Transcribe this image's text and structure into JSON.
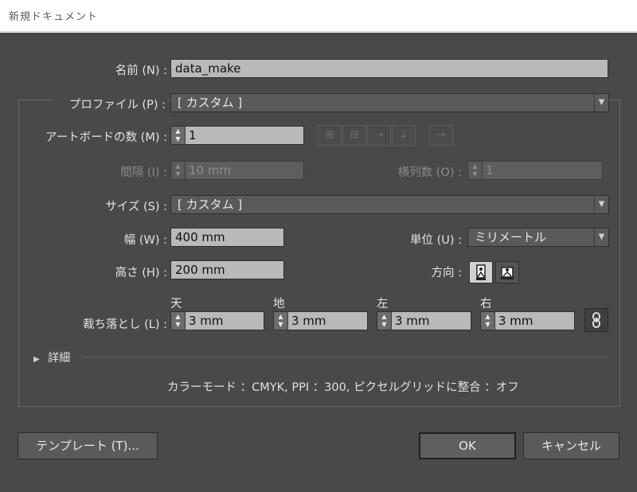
{
  "window": {
    "title": "新規ドキュメント"
  },
  "name": {
    "label": "名前 (N) :",
    "value": "data_make"
  },
  "profile": {
    "label": "プロファイル (P) :",
    "value": "[ カスタム ]"
  },
  "artboards": {
    "label": "アートボードの数 (M) :",
    "value": "1"
  },
  "spacing": {
    "label": "間隔 (I) :",
    "value": "10 mm"
  },
  "columns": {
    "label": "横列数 (O) :",
    "value": "1"
  },
  "size": {
    "label": "サイズ (S) :",
    "value": "[ カスタム ]"
  },
  "width": {
    "label": "幅 (W) :",
    "value": "400 mm"
  },
  "units": {
    "label": "単位 (U) :",
    "value": "ミリメートル"
  },
  "height": {
    "label": "高さ (H) :",
    "value": "200 mm"
  },
  "orientation": {
    "label": "方向 :",
    "selected": "portrait"
  },
  "bleed": {
    "label": "裁ち落とし (L) :",
    "top": {
      "label": "天",
      "value": "3 mm"
    },
    "bottom": {
      "label": "地",
      "value": "3 mm"
    },
    "left": {
      "label": "左",
      "value": "3 mm"
    },
    "right": {
      "label": "右",
      "value": "3 mm"
    }
  },
  "advanced": {
    "label": "詳細"
  },
  "summary": {
    "text": "カラーモード ：CMYK, PPI ：300, ピクセルグリッドに整合 ：オフ"
  },
  "buttons": {
    "templates": "テンプレート (T)...",
    "ok": "OK",
    "cancel": "キャンセル"
  },
  "colors": {
    "dialog_bg": "#494949",
    "field_bg": "#b9b9b9",
    "title_bg": "#ffffff"
  }
}
